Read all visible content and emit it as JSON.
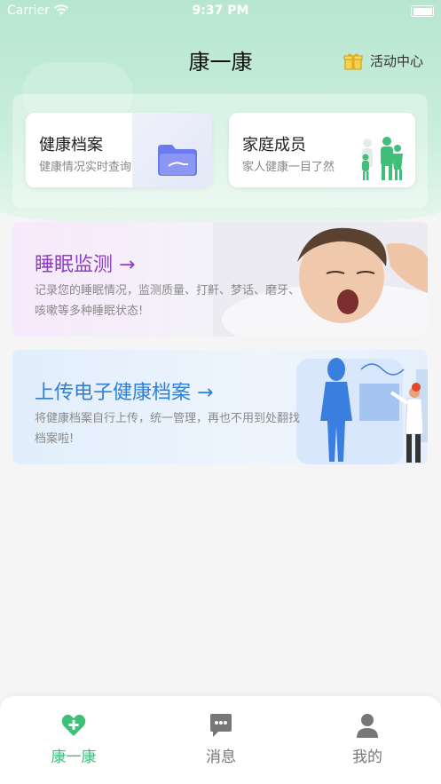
{
  "status_bar": {
    "carrier": "Carrier",
    "time": "9:37 PM"
  },
  "header": {
    "title": "康一康",
    "activity_label": "活动中心",
    "activity_icon": "gift-icon"
  },
  "quick_cards": [
    {
      "title": "健康档案",
      "subtitle": "健康情况实时查询",
      "icon": "folder-icon"
    },
    {
      "title": "家庭成员",
      "subtitle": "家人健康一目了然",
      "icon": "family-icon"
    }
  ],
  "banners": [
    {
      "title": "睡眠监测",
      "desc": "记录您的睡眠情况，监测质量、打鼾、梦话、磨牙、咳嗽等多种睡眠状态!",
      "accent": "#8e3fc3"
    },
    {
      "title": "上传电子健康档案",
      "desc": "将健康档案自行上传，统一管理，再也不用到处翻找档案啦!",
      "accent": "#2f7fd6"
    }
  ],
  "tabbar": {
    "items": [
      {
        "label": "康一康",
        "icon": "heart-plus-icon",
        "active": true
      },
      {
        "label": "消息",
        "icon": "chat-bubble-icon",
        "active": false
      },
      {
        "label": "我的",
        "icon": "person-icon",
        "active": false
      }
    ],
    "active_color": "#3fbf7a"
  },
  "colors": {
    "brand": "#3fbf7a",
    "hero_bg": "#b7e6cf"
  }
}
